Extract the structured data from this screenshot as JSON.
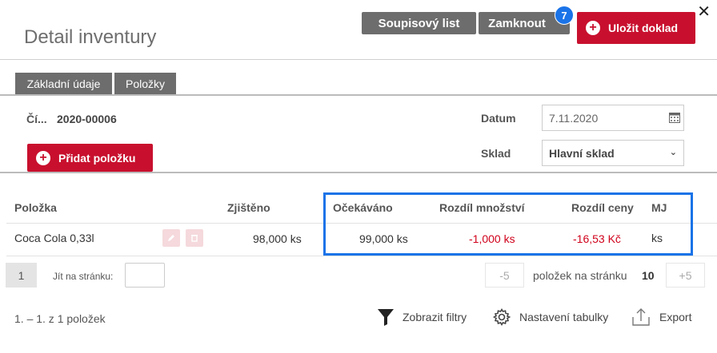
{
  "header": {
    "title": "Detail inventury",
    "soupis_label": "Soupisový list",
    "zamknout_label": "Zamknout",
    "zamknout_badge": "7",
    "save_label": "Uložit doklad",
    "close_glyph": "✕"
  },
  "tabs": [
    {
      "label": "Základní údaje"
    },
    {
      "label": "Položky"
    }
  ],
  "form": {
    "cislo_label": "Čí...",
    "cislo_value": "2020-00006",
    "datum_label": "Datum",
    "datum_value": "7.11.2020",
    "sklad_label": "Sklad",
    "sklad_value": "Hlavní sklad",
    "add_item_label": "Přidat položku"
  },
  "table": {
    "columns": [
      "Položka",
      "Zjištěno",
      "Očekáváno",
      "Rozdíl množství",
      "Rozdíl ceny",
      "MJ"
    ],
    "rows": [
      {
        "polozka": "Coca Cola 0,33l",
        "zjisteno": "98,000 ks",
        "ocekavano": "99,000 ks",
        "rozdil_mnozstvi": "-1,000 ks",
        "rozdil_ceny": "-16,53 Kč",
        "mj": "ks"
      }
    ]
  },
  "pager": {
    "current_page": "1",
    "jump_label": "Jít na stránku:",
    "minus_label": "-5",
    "per_page_label": "položek na stránku",
    "per_page_value": "10",
    "plus_label": "+5"
  },
  "footer": {
    "count_label": "1. – 1. z 1 položek",
    "filter_label": "Zobrazit filtry",
    "settings_label": "Nastavení tabulky",
    "export_label": "Export"
  },
  "colors": {
    "accent_red": "#c8102e",
    "button_gray": "#6d6d6d",
    "highlight_blue": "#1a73e8",
    "negative_red": "#d0021b"
  },
  "icons": [
    "close-icon",
    "plus-circle-icon",
    "calendar-icon",
    "chevron-down-icon",
    "edit-icon",
    "delete-icon",
    "filter-icon",
    "gear-icon",
    "export-icon"
  ]
}
